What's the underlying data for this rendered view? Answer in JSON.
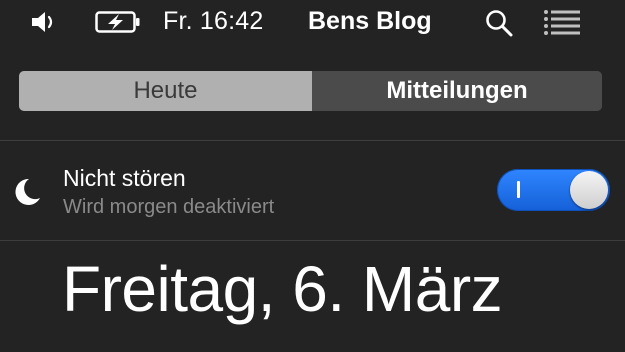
{
  "menubar": {
    "icons": [
      "speaker-icon",
      "battery-charging-icon",
      "search-icon",
      "list-icon"
    ],
    "clock": "Fr. 16:42",
    "user_name": "Bens Blog"
  },
  "notification_center": {
    "tabs": [
      {
        "label": "Heute",
        "active": false
      },
      {
        "label": "Mitteilungen",
        "active": true
      }
    ],
    "do_not_disturb": {
      "title": "Nicht stören",
      "subtitle": "Wird morgen deaktiviert",
      "enabled": true,
      "icon": "moon-icon"
    },
    "date_heading": "Freitag, 6. März"
  },
  "colors": {
    "background": "#232323",
    "toggle_on": "#1f6ff0",
    "tab_inactive_bg": "#b0b0b0",
    "tab_active_bg": "#4b4b4b",
    "subtitle_text": "#8a8a8a"
  }
}
